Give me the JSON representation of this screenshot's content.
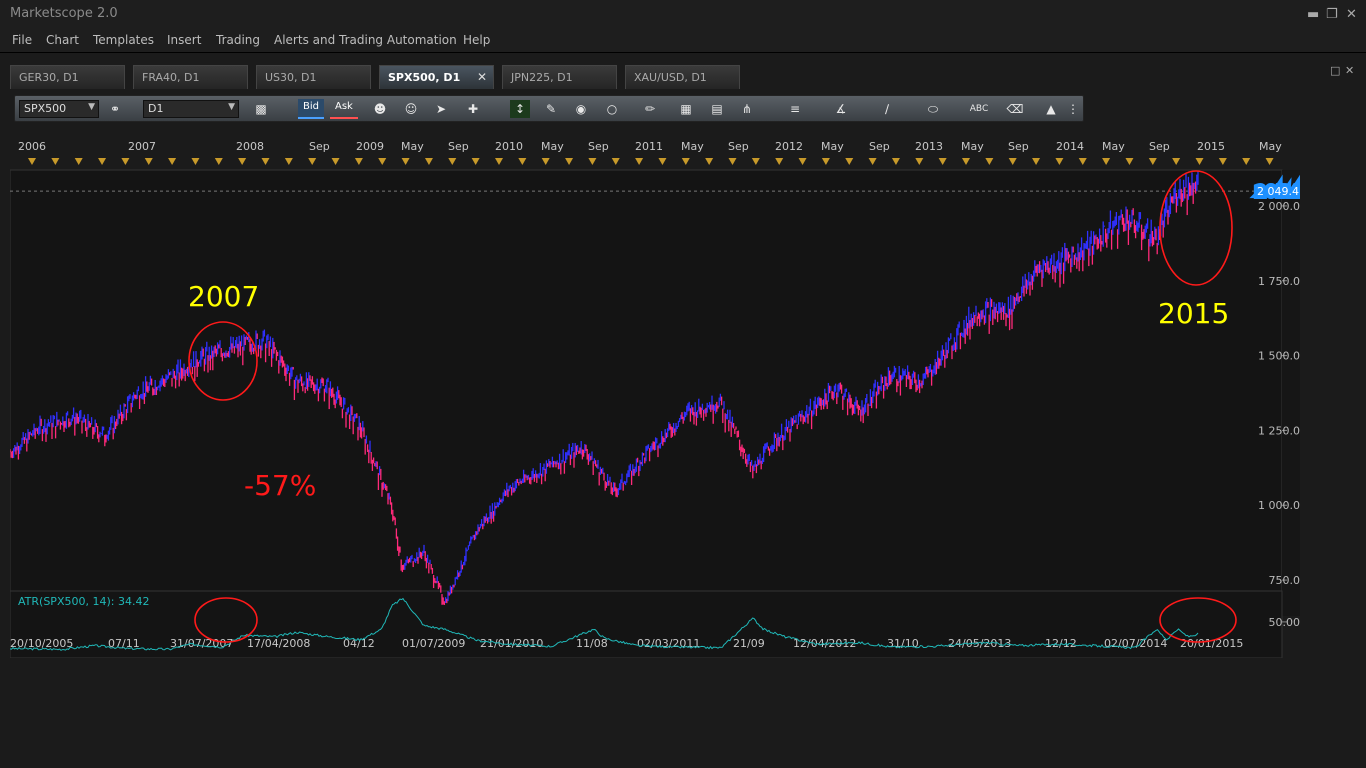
{
  "window": {
    "title": "Marketscope 2.0"
  },
  "menu": [
    "File",
    "Chart",
    "Templates",
    "Insert",
    "Trading",
    "Alerts and Trading Automation",
    "Help"
  ],
  "tabs": [
    {
      "label": "GER30, D1",
      "active": false
    },
    {
      "label": "FRA40, D1",
      "active": false
    },
    {
      "label": "US30, D1",
      "active": false
    },
    {
      "label": "SPX500, D1",
      "active": true
    },
    {
      "label": "JPN225, D1",
      "active": false
    },
    {
      "label": "XAU/USD, D1",
      "active": false
    }
  ],
  "toolbar": {
    "instrument": "SPX500",
    "timeframe": "D1",
    "bid_label": "Bid",
    "ask_label": "Ask"
  },
  "colors": {
    "bg": "#141414",
    "up": "#3030ff",
    "down": "#ff2a7a",
    "atr": "#20b8b8",
    "annotation_yellow": "#ffff00",
    "annotation_red": "#ff1a1a",
    "price_badge": "#1e90ff"
  },
  "chart_data": [
    {
      "type": "line",
      "instrument": "SPX500",
      "timeframe": "D1",
      "top_time_labels": [
        "2006",
        "2007",
        "2008",
        "Sep",
        "2009",
        "May",
        "Sep",
        "2010",
        "May",
        "Sep",
        "2011",
        "May",
        "Sep",
        "2012",
        "May",
        "Sep",
        "2013",
        "May",
        "Sep",
        "2014",
        "May",
        "Sep",
        "2015",
        "May"
      ],
      "bottom_date_labels": [
        "20/10/2005",
        "07/11",
        "31/07/2007",
        "17/04/2008",
        "04/12",
        "01/07/2009",
        "21/01/2010",
        "11/08",
        "02/03/2011",
        "21/09",
        "12/04/2012",
        "31/10",
        "24/05/2013",
        "12/12",
        "02/07/2014",
        "20/01/2015"
      ],
      "y_tick_labels": [
        "2 000.0",
        "1 750.0",
        "1 500.0",
        "1 250.0",
        "1 000.0",
        "750.0"
      ],
      "ylim": [
        630,
        2120
      ],
      "current_price_label": "2 049.4",
      "current_price": 2049.4,
      "x": [
        "2005-10",
        "2006-01",
        "2006-04",
        "2006-07",
        "2006-10",
        "2007-01",
        "2007-04",
        "2007-07",
        "2007-10",
        "2008-01",
        "2008-04",
        "2008-07",
        "2008-10",
        "2008-11",
        "2009-01",
        "2009-03",
        "2009-06",
        "2009-09",
        "2010-01",
        "2010-04",
        "2010-07",
        "2010-10",
        "2011-02",
        "2011-05",
        "2011-08",
        "2011-10",
        "2012-01",
        "2012-04",
        "2012-06",
        "2012-09",
        "2012-12",
        "2013-03",
        "2013-05",
        "2013-08",
        "2013-11",
        "2014-01",
        "2014-04",
        "2014-07",
        "2014-10",
        "2014-12",
        "2015-02"
      ],
      "values": [
        1180,
        1270,
        1300,
        1240,
        1380,
        1430,
        1500,
        1530,
        1560,
        1420,
        1400,
        1270,
        1000,
        800,
        850,
        680,
        920,
        1060,
        1140,
        1200,
        1050,
        1180,
        1320,
        1350,
        1120,
        1220,
        1310,
        1400,
        1320,
        1440,
        1420,
        1560,
        1650,
        1660,
        1800,
        1820,
        1880,
        1970,
        1900,
        2060,
        2090
      ],
      "annotations": [
        {
          "text": "2007",
          "color": "#ffff00",
          "x": "2007-09",
          "y": 1520
        },
        {
          "text": "-57%",
          "color": "#ff1a1a",
          "x": "2008-10",
          "y": 1050
        },
        {
          "text": "2015",
          "color": "#ffff00",
          "x": "2014-12",
          "y": 1980
        }
      ]
    },
    {
      "type": "line",
      "name": "ATR(SPX500, 14): 34.42",
      "y_tick_labels": [
        "50.00"
      ],
      "ylim": [
        8,
        85
      ],
      "x": [
        "2005-10",
        "2006-03",
        "2006-06",
        "2006-09",
        "2007-01",
        "2007-03",
        "2007-06",
        "2007-08",
        "2007-11",
        "2008-01",
        "2008-04",
        "2008-07",
        "2008-09",
        "2008-10",
        "2008-11",
        "2009-01",
        "2009-03",
        "2009-06",
        "2009-09",
        "2010-01",
        "2010-05",
        "2010-06",
        "2010-09",
        "2011-01",
        "2011-05",
        "2011-08",
        "2011-09",
        "2011-11",
        "2012-02",
        "2012-06",
        "2012-09",
        "2013-01",
        "2013-06",
        "2013-09",
        "2014-01",
        "2014-04",
        "2014-08",
        "2014-10",
        "2014-11",
        "2014-12",
        "2015-01",
        "2015-02"
      ],
      "values": [
        14,
        13,
        18,
        14,
        13,
        20,
        16,
        32,
        30,
        36,
        30,
        26,
        40,
        72,
        82,
        45,
        40,
        25,
        20,
        17,
        40,
        28,
        18,
        16,
        15,
        55,
        40,
        30,
        20,
        22,
        16,
        17,
        22,
        18,
        20,
        18,
        15,
        40,
        26,
        40,
        30,
        34
      ]
    }
  ]
}
